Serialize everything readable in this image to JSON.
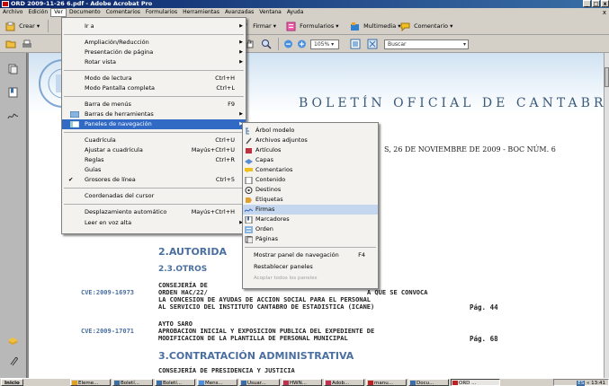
{
  "window": {
    "title": "ORD 2009-11-26 6.pdf - Adobe Acrobat Pro",
    "controls": [
      "_",
      "□",
      "x"
    ]
  },
  "menubar": {
    "items": [
      "Archivo",
      "Edición",
      "Ver",
      "Documento",
      "Comentarios",
      "Formularios",
      "Herramientas",
      "Avanzadas",
      "Ventana",
      "Ayuda"
    ],
    "close": "x"
  },
  "toolbar1": {
    "create": "Crear",
    "sign": "Firmar",
    "forms": "Formularios",
    "multimedia": "Multimedia",
    "comment": "Comentario"
  },
  "toolbar2": {
    "zoom": "105%",
    "search_placeholder": "Buscar"
  },
  "view_menu": {
    "items": [
      {
        "label": "Ir a",
        "accel": "",
        "submenu": true
      },
      {
        "label": "Ampliación/Reducción",
        "accel": "",
        "submenu": true
      },
      {
        "label": "Presentación de página",
        "accel": "",
        "submenu": true
      },
      {
        "label": "Rotar vista",
        "accel": "",
        "submenu": true
      },
      {
        "label": "Modo de lectura",
        "accel": "Ctrl+H",
        "submenu": false
      },
      {
        "label": "Modo Pantalla completa",
        "accel": "Ctrl+L",
        "submenu": false
      },
      {
        "label": "Barra de menús",
        "accel": "F9",
        "submenu": false
      },
      {
        "label": "Barras de herramientas",
        "accel": "",
        "submenu": true
      },
      {
        "label": "Paneles de navegación",
        "accel": "",
        "submenu": true
      },
      {
        "label": "Cuadrícula",
        "accel": "Ctrl+U",
        "submenu": false
      },
      {
        "label": "Ajustar a cuadrícula",
        "accel": "Mayús+Ctrl+U",
        "submenu": false
      },
      {
        "label": "Reglas",
        "accel": "Ctrl+R",
        "submenu": false
      },
      {
        "label": "Guías",
        "accel": "",
        "submenu": false
      },
      {
        "label": "Grosores de línea",
        "accel": "Ctrl+5",
        "submenu": false,
        "checked": true
      },
      {
        "label": "Coordenadas del cursor",
        "accel": "",
        "submenu": false
      },
      {
        "label": "Desplazamiento automático",
        "accel": "Mayús+Ctrl+H",
        "submenu": false
      },
      {
        "label": "Leer en voz alta",
        "accel": "",
        "submenu": true
      }
    ],
    "highlighted": "Paneles de navegación",
    "check_mark": "✔",
    "arrow": "▶"
  },
  "nav_submenu": {
    "items": [
      "Árbol modelo",
      "Archivos adjuntos",
      "Artículos",
      "Capas",
      "Comentarios",
      "Contenido",
      "Destinos",
      "Etiquetas",
      "Firmas",
      "Marcadores",
      "Orden",
      "Páginas"
    ],
    "highlighted": "Firmas",
    "show_panel": "Mostrar panel de navegación",
    "show_panel_accel": "F4",
    "reset": "Restablecer paneles",
    "dock_all": "Acoplar todos los paneles"
  },
  "document": {
    "banner_title": "BOLETÍN OFICIAL DE CANTABRIA",
    "header_line": "S, 26 DE NOVIEMBRE DE 2009 - BOC NÚM. 6",
    "section1": "2.AUTORIDA",
    "subsection1": "2.3.OTROS",
    "entry1": {
      "cve": "CVE:2009-16973",
      "lines": [
        "CONSEJERÍA DE",
        "ORDEN HAC/22/",
        "LA CONCESION DE AYUDAS DE ACCION SOCIAL PARA EL PERSONAL",
        "AL SERVICIO DEL INSTITUTO CANTABRO DE ESTADISTICA (ICANE)"
      ],
      "line2_tail": "A QUE SE CONVOCA",
      "page": "Pág. 44"
    },
    "entry2": {
      "cve": "CVE:2009-17071",
      "lines": [
        "AYTO SARO",
        "APROBACION INICIAL Y EXPOSICION PUBLICA DEL EXPEDIENTE DE",
        "MODIFICACION DE LA PLANTILLA DE PERSONAL MUNICIPAL"
      ],
      "page": "Pág. 68"
    },
    "section2": "3.CONTRATACIÓN ADMINISTRATIVA",
    "entry3_line": "CONSEJERÍA DE PRESIDENCIA Y JUSTICIA"
  },
  "taskbar": {
    "start": "Inicio",
    "tasks": [
      "Eleme...",
      "Boletí...",
      "Boletí...",
      "Mens...",
      "Usuar...",
      "HWN...",
      "Adob...",
      "manu...",
      "Docu...",
      "ORD ..."
    ],
    "clock": "13:41",
    "lang": "ES"
  }
}
